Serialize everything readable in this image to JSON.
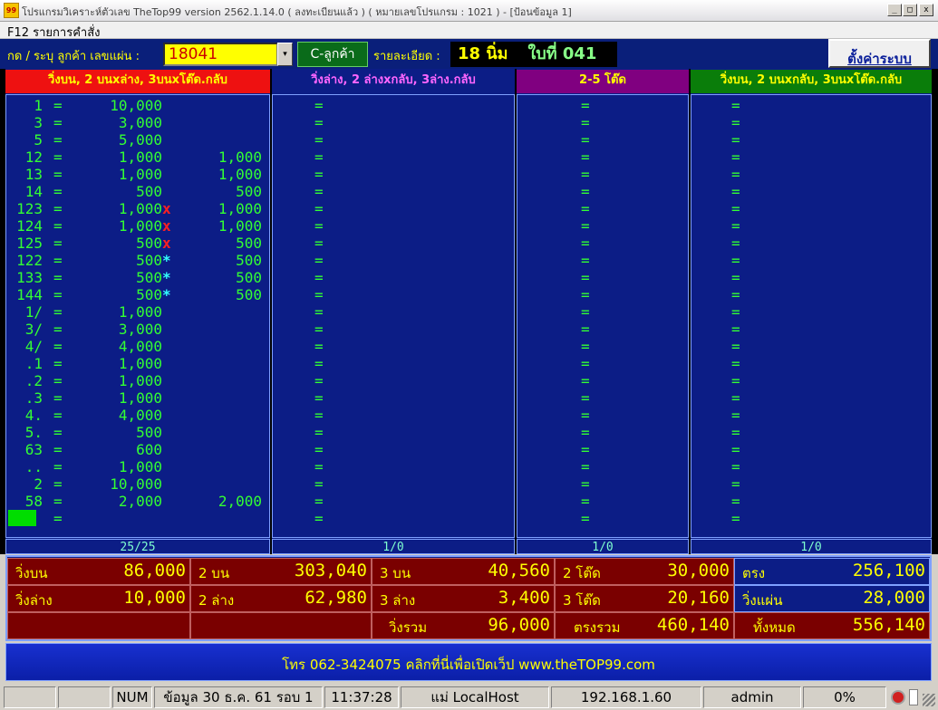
{
  "window": {
    "title": "โปรแกรมวิเคราะห์ตัวเลข TheTop99  version 2562.1.14.0  ( ลงทะเบียนแล้ว )   (   หมายเลขโปรแกรม : 1021   ) - [ป้อนข้อมูล 1]",
    "icon_label": "99",
    "min": "_",
    "max": "□",
    "close": "x"
  },
  "menu": {
    "f12": "F12 รายการคำสั่ง"
  },
  "toolbar": {
    "customer_label": "กด / ระบุ ลูกค้า  เลขแผ่น :",
    "customer_value": "18041",
    "dropdown_icon": "▾",
    "customer_button": "C-ลูกค้า",
    "detail_label": "รายละเอียด :",
    "detail_name": "18 นิ่ม",
    "detail_sheet": "ใบที่ 041",
    "settings_button": "ตั้งค่าระบบ"
  },
  "colors": {
    "red_header": "#ee1111",
    "purple_header": "#800080",
    "green_header": "#0a7d0a",
    "body": "#0c1d86",
    "digits": "#33ff33",
    "summary_bg": "#7a0000"
  },
  "columns": [
    {
      "header": "วิ่งบน, 2 บนxล่าง, 3บนxโต๊ด.กลับ",
      "footer": "25/25"
    },
    {
      "header": "วิ่งล่าง, 2 ล่างxกลับ, 3ล่าง.กลับ",
      "footer": "1/0"
    },
    {
      "header": "2-5 โต๊ด",
      "footer": "1/0"
    },
    {
      "header": "วิ่งบน, 2 บนxกลับ, 3บนxโต๊ด.กลับ",
      "footer": "1/0"
    }
  ],
  "entries": [
    {
      "num": "1",
      "eq": "=",
      "v1": "10,000",
      "mark": "",
      "v2": ""
    },
    {
      "num": "3",
      "eq": "=",
      "v1": "3,000",
      "mark": "",
      "v2": ""
    },
    {
      "num": "5",
      "eq": "=",
      "v1": "5,000",
      "mark": "",
      "v2": ""
    },
    {
      "num": "12",
      "eq": "=",
      "v1": "1,000",
      "mark": "",
      "v2": "1,000"
    },
    {
      "num": "13",
      "eq": "=",
      "v1": "1,000",
      "mark": "",
      "v2": "1,000"
    },
    {
      "num": "14",
      "eq": "=",
      "v1": "500",
      "mark": "",
      "v2": "500"
    },
    {
      "num": "123",
      "eq": "=",
      "v1": "1,000",
      "mark": "x",
      "v2": "1,000"
    },
    {
      "num": "124",
      "eq": "=",
      "v1": "1,000",
      "mark": "x",
      "v2": "1,000"
    },
    {
      "num": "125",
      "eq": "=",
      "v1": "500",
      "mark": "x",
      "v2": "500"
    },
    {
      "num": "122",
      "eq": "=",
      "v1": "500",
      "mark": "*",
      "v2": "500"
    },
    {
      "num": "133",
      "eq": "=",
      "v1": "500",
      "mark": "*",
      "v2": "500"
    },
    {
      "num": "144",
      "eq": "=",
      "v1": "500",
      "mark": "*",
      "v2": "500"
    },
    {
      "num": "1/",
      "eq": "=",
      "v1": "1,000",
      "mark": "",
      "v2": ""
    },
    {
      "num": "3/",
      "eq": "=",
      "v1": "3,000",
      "mark": "",
      "v2": ""
    },
    {
      "num": "4/",
      "eq": "=",
      "v1": "4,000",
      "mark": "",
      "v2": ""
    },
    {
      "num": ".1",
      "eq": "=",
      "v1": "1,000",
      "mark": "",
      "v2": ""
    },
    {
      "num": ".2",
      "eq": "=",
      "v1": "1,000",
      "mark": "",
      "v2": ""
    },
    {
      "num": ".3",
      "eq": "=",
      "v1": "1,000",
      "mark": "",
      "v2": ""
    },
    {
      "num": "4.",
      "eq": "=",
      "v1": "4,000",
      "mark": "",
      "v2": ""
    },
    {
      "num": "5.",
      "eq": "=",
      "v1": "500",
      "mark": "",
      "v2": ""
    },
    {
      "num": "63",
      "eq": "=",
      "v1": "600",
      "mark": "",
      "v2": ""
    },
    {
      "num": "..",
      "eq": "=",
      "v1": "1,000",
      "mark": "",
      "v2": ""
    },
    {
      "num": "2",
      "eq": "=",
      "v1": "10,000",
      "mark": "",
      "v2": ""
    },
    {
      "num": "58",
      "eq": "=",
      "v1": "2,000",
      "mark": "",
      "v2": "2,000"
    },
    {
      "num": "",
      "eq": "=",
      "v1": "",
      "mark": "",
      "v2": ""
    }
  ],
  "empty_rows_eq": "=",
  "summary": {
    "r1": [
      {
        "label": "วิ่งบน",
        "value": "86,000"
      },
      {
        "label": "2 บน",
        "value": "303,040"
      },
      {
        "label": "3 บน",
        "value": "40,560"
      },
      {
        "label": "2 โต๊ด",
        "value": "30,000"
      },
      {
        "label": "ตรง",
        "value": "256,100"
      }
    ],
    "r2": [
      {
        "label": "วิ่งล่าง",
        "value": "10,000"
      },
      {
        "label": "2 ล่าง",
        "value": "62,980"
      },
      {
        "label": "3 ล่าง",
        "value": "3,400"
      },
      {
        "label": "3 โต๊ด",
        "value": "20,160"
      },
      {
        "label": "วิ่งแผ่น",
        "value": "28,000"
      }
    ],
    "r3": [
      {
        "label": "วิ่งรวม",
        "value": "96,000"
      },
      {
        "label": "ตรงรวม",
        "value": "460,140"
      },
      {
        "label": "ทั้งหมด",
        "value": "556,140"
      }
    ]
  },
  "footer": {
    "text": "โทร  062-3424075  คลิกที่นี่เพื่อเปิดเว็ป www.theTOP99.com"
  },
  "status": {
    "num": "NUM",
    "data": "ข้อมูล 30 ธ.ค. 61 รอบ 1",
    "time": "11:37:28",
    "host": "แม่ LocalHost",
    "ip": "192.168.1.60",
    "user": "admin",
    "percent": "0%"
  }
}
